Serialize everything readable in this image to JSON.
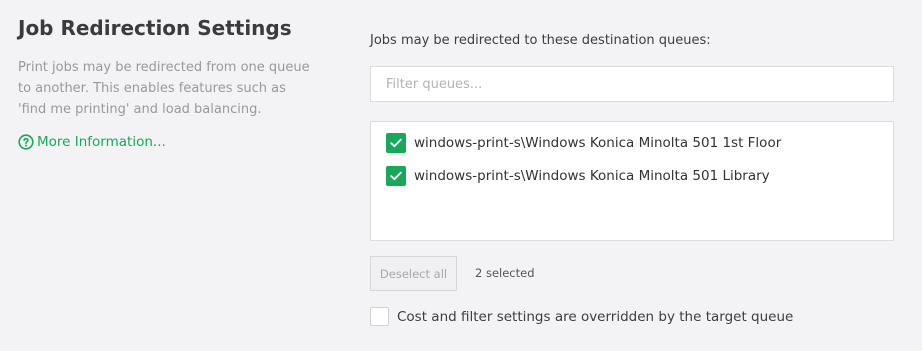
{
  "section": {
    "title": "Job Redirection Settings",
    "description": "Print jobs may be redirected from one queue to another. This enables features such as 'find me printing' and load balancing.",
    "more_info_label": "More Information...",
    "more_info_icon": "question-circle-icon"
  },
  "queues": {
    "label": "Jobs may be redirected to these destination queues:",
    "filter_placeholder": "Filter queues...",
    "filter_value": "",
    "items": [
      {
        "label": "windows-print-s\\Windows Konica Minolta 501 1st Floor",
        "checked": true
      },
      {
        "label": "windows-print-s\\Windows Konica Minolta 501 Library",
        "checked": true
      }
    ],
    "deselect_label": "Deselect all",
    "selected_count": "2 selected"
  },
  "override": {
    "label": "Cost and filter settings are overridden by the target queue",
    "checked": false
  },
  "colors": {
    "accent": "#17a85a",
    "background": "#f3f3f6"
  }
}
